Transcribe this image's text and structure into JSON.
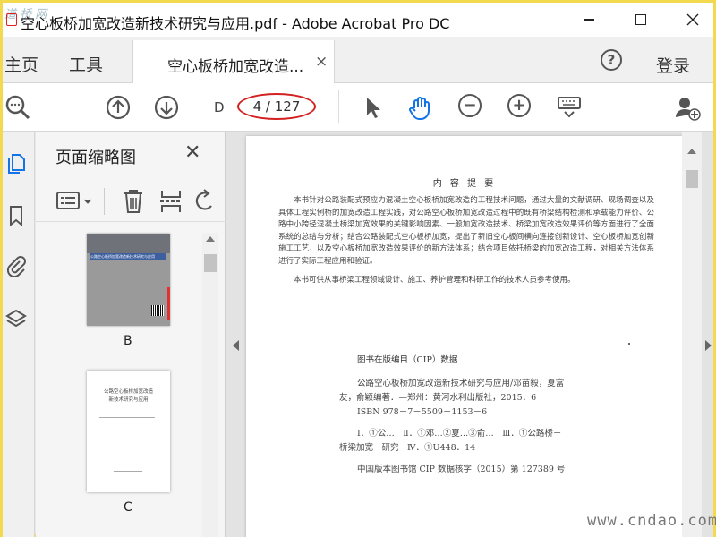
{
  "window": {
    "title": "空心板桥加宽改造新技术研究与应用.pdf - Adobe Acrobat Pro DC",
    "watermark_top": "道 桥 网",
    "watermark_bottom": "www.cndao.com"
  },
  "menubar": {
    "home": "主页",
    "tools": "工具",
    "doc_tab": "空心板桥加宽改造...",
    "doc_tab_close": "×",
    "help": "?",
    "login": "登录"
  },
  "toolbar": {
    "page_prefix": "D",
    "page_indicator": "4 / 127",
    "zoom_out": "−",
    "zoom_in": "+"
  },
  "sidepanel": {
    "title": "页面缩略图",
    "close": "✕",
    "thumbnails": [
      {
        "label": "B",
        "cover_text": "公路空心板桥加宽改造新技术研究与应用"
      },
      {
        "label": "C",
        "title_lines": [
          "公路空心板桥加宽改造",
          "新技术研究与应用"
        ]
      }
    ]
  },
  "document": {
    "heading": "内 容 提 要",
    "abstract": "本书针对公路装配式预应力混凝土空心板桥加宽改造的工程技术问题，通过大量的文献调研、现场调查以及具体工程实例桥的加宽改造工程实践，对公路空心板桥加宽改造过程中的既有桥梁结构检测和承载能力评价、公路中小跨径混凝土桥梁加宽效果的关键影响因素、一般加宽改造技术、桥梁加宽改造效果评价等方面进行了全面系统的总结与分析；结合公路装配式空心板桥加宽，提出了新旧空心板间横向连接创新设计、空心板桥加宽创新施工工艺，以及空心板桥加宽改造效果评价的新方法体系；结合项目依托桥梁的加宽改造工程，对相关方法体系进行了实际工程应用和验证。",
    "abstract2": "本书可供从事桥梁工程领域设计、施工、养护管理和科研工作的技术人员参考使用。",
    "cip_title": "图书在版编目（CIP）数据",
    "cip_lines": [
      "公路空心板桥加宽改造新技术研究与应用/邓苗毅，夏富",
      "友，俞颖编著．—郑州：黄河水利出版社，2015．6",
      "ISBN 978－7－5509－1153－6",
      "Ⅰ．①公…　Ⅱ．①邓…②夏…③俞…　Ⅲ．①公路桥－",
      "桥梁加宽－研究　Ⅳ．①U448．14",
      "中国版本图书馆 CIP 数据核字（2015）第 127389 号"
    ]
  }
}
